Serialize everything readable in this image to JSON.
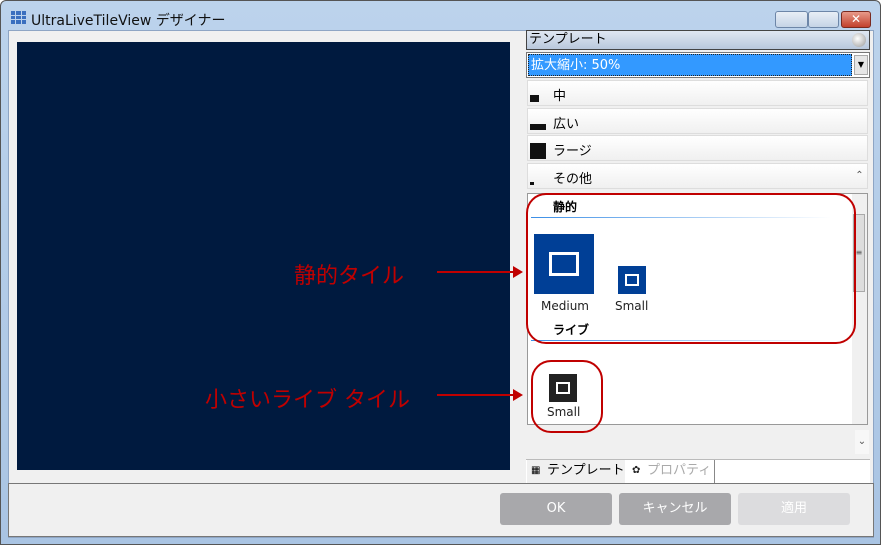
{
  "window": {
    "title": "UltraLiveTileView デザイナー",
    "close_glyph": "✕"
  },
  "panel": {
    "header": "テンプレート",
    "zoom_value": "拡大縮小: 50%",
    "categories": [
      {
        "label": "中"
      },
      {
        "label": "広い"
      },
      {
        "label": "ラージ"
      },
      {
        "label": "その他"
      }
    ],
    "groups": {
      "static": "静的",
      "live": "ライブ"
    },
    "tiles": {
      "medium": "Medium",
      "small": "Small",
      "live_small": "Small"
    }
  },
  "tabs": [
    {
      "label": "テンプレート"
    },
    {
      "label": "プロパティ"
    }
  ],
  "buttons": {
    "ok": "OK",
    "cancel": "キャンセル",
    "apply": "適用"
  },
  "annotations": {
    "static_tile": "静的タイル",
    "small_live_tile": "小さいライブ タイル"
  },
  "colors": {
    "preview": "#001a3f",
    "tile_blue": "#003f96",
    "accent": "#3399ff",
    "annotation": "#c00000"
  }
}
